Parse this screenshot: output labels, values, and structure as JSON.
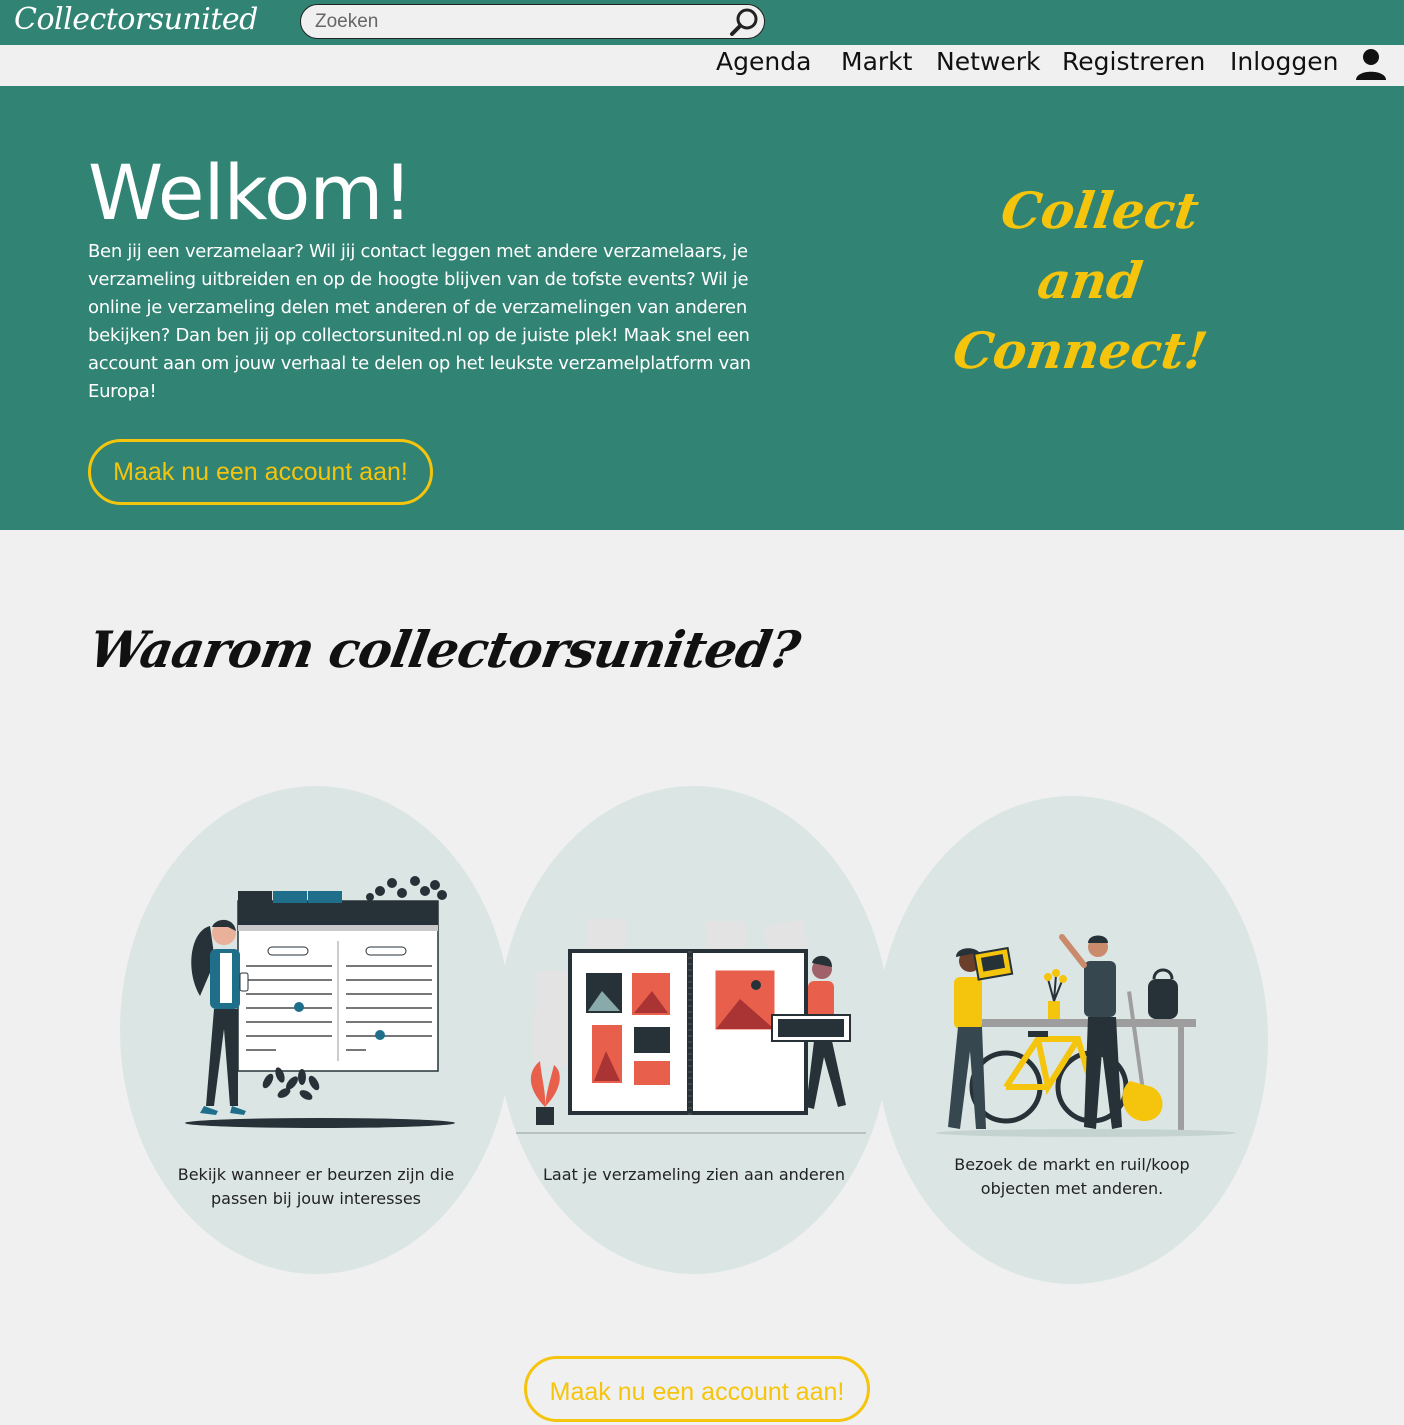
{
  "header": {
    "logo_text": "Collectorsunited",
    "search_placeholder": "Zoeken"
  },
  "nav": {
    "items": [
      {
        "label": "Agenda"
      },
      {
        "label": "Markt"
      },
      {
        "label": "Netwerk"
      },
      {
        "label": "Registreren"
      },
      {
        "label": "Inloggen"
      }
    ]
  },
  "hero": {
    "title": "Welkom!",
    "text": "Ben jij een verzamelaar? Wil jij contact leggen met andere verzamelaars, je verzameling uitbreiden en op de hoogte blijven van de tofste events? Wil je online je verzameling delen met anderen of de verzamelingen van anderen bekijken? Dan ben jij op collectorsunited.nl op de juiste plek! Maak snel een account aan om jouw verhaal te delen op het leukste verzamelplatform van Europa!",
    "button_label": "Maak nu een account aan!",
    "tagline": [
      "Collect",
      "and",
      "Connect!"
    ]
  },
  "why": {
    "title": "Waarom collectorsunited?",
    "features": [
      {
        "caption": "Bekijk wanneer er beurzen zijn die passen bij jouw interesses",
        "icon": "calendar-illustration"
      },
      {
        "caption": "Laat je verzameling zien aan anderen",
        "icon": "photo-album-illustration"
      },
      {
        "caption": "Bezoek de markt en ruil/koop objecten met anderen.",
        "icon": "market-illustration"
      }
    ],
    "button_label": "Maak nu een account aan!"
  },
  "colors": {
    "brand_green": "#318474",
    "accent_yellow": "#f5c40c",
    "background": "#f0f0f0",
    "bubble": "#dbe6e4"
  }
}
